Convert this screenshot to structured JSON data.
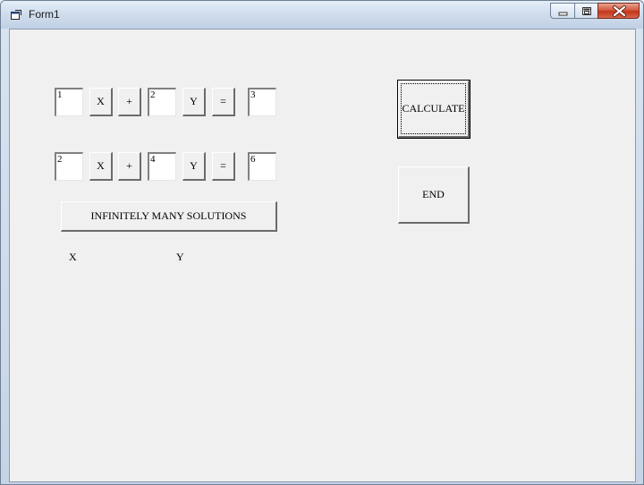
{
  "window": {
    "title": "Form1",
    "app_icon": "vb-form-icon",
    "controls": {
      "minimize": "minimize-icon",
      "maximize": "maximize-icon",
      "close": "close-icon"
    }
  },
  "equation1": {
    "a": "1",
    "x_label": "X",
    "plus_label": "+",
    "b": "2",
    "y_label": "Y",
    "equals_label": "=",
    "c": "3"
  },
  "equation2": {
    "a": "2",
    "x_label": "X",
    "plus_label": "+",
    "b": "4",
    "y_label": "Y",
    "equals_label": "=",
    "c": "6"
  },
  "result": {
    "message": "INFINITELY MANY SOLUTIONS",
    "x_label": "X",
    "y_label": "Y"
  },
  "actions": {
    "calculate_label": "CALCULATE",
    "end_label": "END"
  }
}
